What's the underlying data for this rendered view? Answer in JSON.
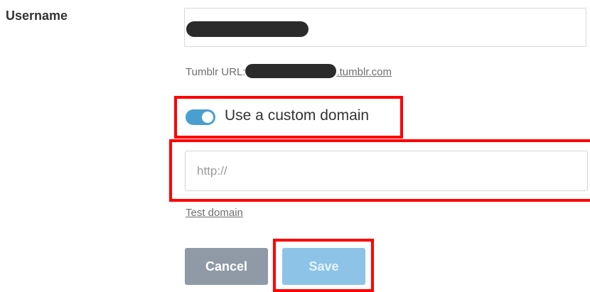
{
  "form": {
    "username_label": "Username",
    "username_value": "",
    "tumblr_url_label": "Tumblr URL:",
    "tumblr_url_suffix": ".tumblr.com",
    "custom_domain_label": "Use a custom domain",
    "custom_domain_enabled": true,
    "domain_placeholder": "http://",
    "domain_value": "",
    "test_domain_label": "Test domain"
  },
  "buttons": {
    "cancel_label": "Cancel",
    "save_label": "Save"
  },
  "colors": {
    "toggle_on": "#4a9fd1",
    "cancel_bg": "#8f9aa6",
    "save_bg": "#8cc3e6",
    "highlight": "#ff0000"
  }
}
